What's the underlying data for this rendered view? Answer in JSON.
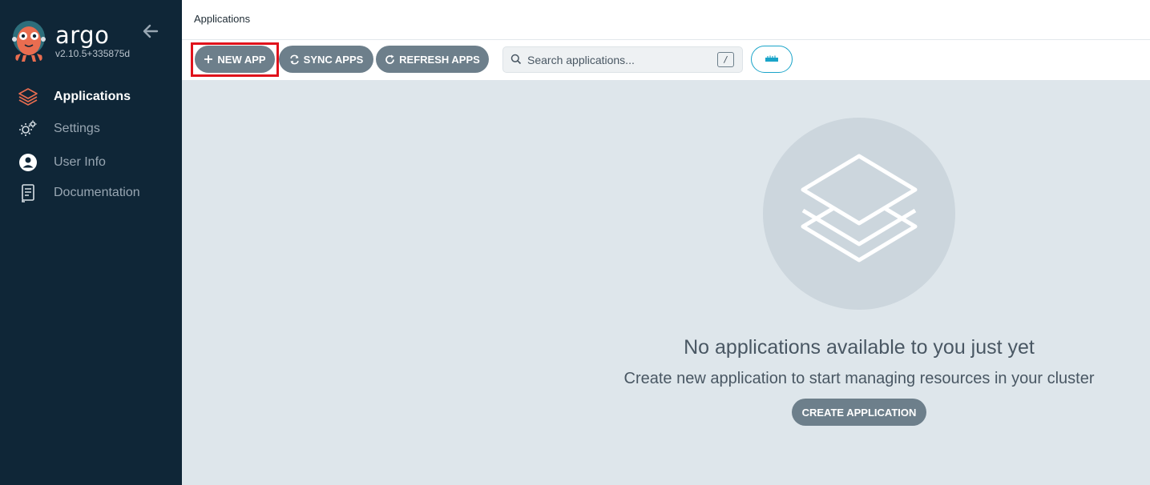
{
  "sidebar": {
    "brand": "argo",
    "version": "v2.10.5+335875d",
    "items": [
      {
        "label": "Applications",
        "icon": "stack-icon",
        "active": true
      },
      {
        "label": "Settings",
        "icon": "gears-icon",
        "active": false
      },
      {
        "label": "User Info",
        "icon": "user-circle-icon",
        "active": false
      },
      {
        "label": "Documentation",
        "icon": "book-icon",
        "active": false
      }
    ]
  },
  "header": {
    "breadcrumb": "Applications"
  },
  "toolbar": {
    "new_app_label": "NEW APP",
    "sync_apps_label": "SYNC APPS",
    "refresh_apps_label": "REFRESH APPS",
    "search_placeholder": "Search applications...",
    "search_shortcut": "/",
    "view_icon": "ruler-icon"
  },
  "empty_state": {
    "title": "No applications available to you just yet",
    "subtitle": "Create new application to start managing resources in your cluster",
    "create_label": "CREATE APPLICATION"
  },
  "colors": {
    "sidebar_bg": "#0f2637",
    "accent": "#e96d50",
    "button": "#6d7f8b",
    "highlight": "#e0121b",
    "view_toggle": "#1aa4c9"
  }
}
